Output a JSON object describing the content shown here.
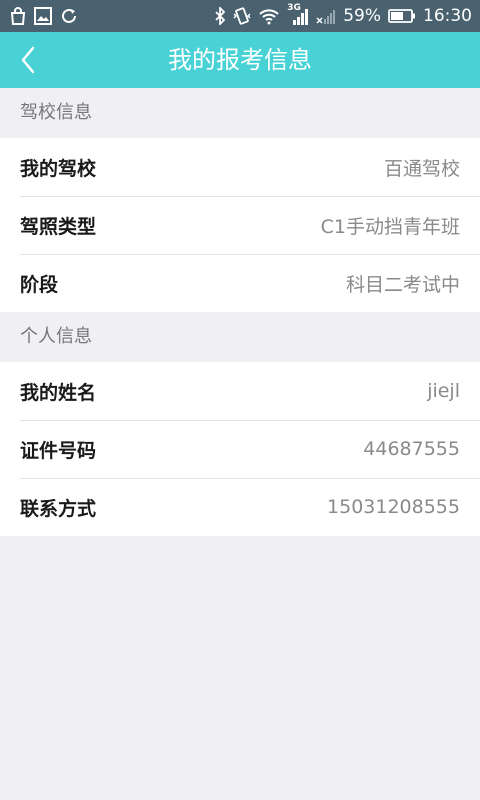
{
  "status_bar": {
    "battery": "59%",
    "time": "16:30",
    "network": "3G",
    "icons": [
      "shopping-bag-icon",
      "image-icon",
      "sync-icon",
      "bluetooth-icon",
      "vibrate-icon",
      "wifi-icon",
      "signal-icon",
      "no-signal-icon",
      "battery-icon"
    ]
  },
  "app_bar": {
    "title": "我的报考信息",
    "back_icon": "chevron-left-icon",
    "background": "#48d2d6"
  },
  "sections": [
    {
      "header": "驾校信息",
      "rows": [
        {
          "label": "我的驾校",
          "value": "百通驾校"
        },
        {
          "label": "驾照类型",
          "value": "C1手动挡青年班"
        },
        {
          "label": "阶段",
          "value": "科目二考试中"
        }
      ]
    },
    {
      "header": "个人信息",
      "rows": [
        {
          "label": "我的姓名",
          "value": "jiejl"
        },
        {
          "label": "证件号码",
          "value": "44687555"
        },
        {
          "label": "联系方式",
          "value": "15031208555"
        }
      ]
    }
  ]
}
